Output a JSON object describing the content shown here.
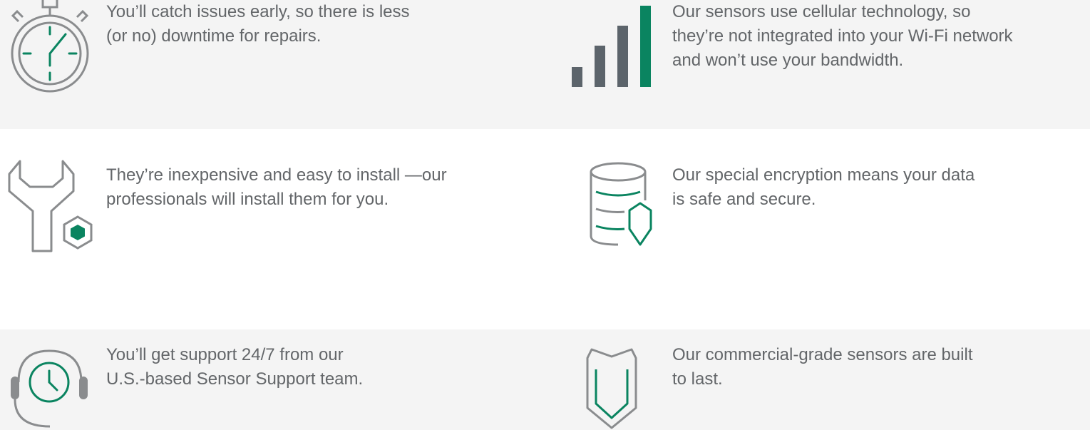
{
  "colors": {
    "background_band": "#f4f4f4",
    "icon_gray": "#8a8c8e",
    "icon_dark_gray": "#5c646b",
    "accent_green": "#0a8460",
    "text_gray": "#636669"
  },
  "features": [
    {
      "icon": "stopwatch-icon",
      "lines": [
        "You’ll catch issues early, so there is less",
        "(or no) downtime for repairs."
      ]
    },
    {
      "icon": "signal-bars-icon",
      "lines": [
        "Our sensors use cellular technology, so",
        "they’re not integrated into your Wi-Fi network",
        "and won’t use your bandwidth."
      ]
    },
    {
      "icon": "wrench-nut-icon",
      "lines": [
        "They’re inexpensive and easy to install —our",
        "professionals will install them for you."
      ]
    },
    {
      "icon": "database-shield-icon",
      "lines": [
        "Our special encryption means your data",
        "is safe and secure."
      ]
    },
    {
      "icon": "headset-clock-icon",
      "lines": [
        "You’ll get support 24/7 from our",
        "U.S.-based Sensor Support team."
      ]
    },
    {
      "icon": "shield-icon",
      "lines": [
        "Our commercial-grade sensors are built",
        "to last."
      ]
    }
  ]
}
